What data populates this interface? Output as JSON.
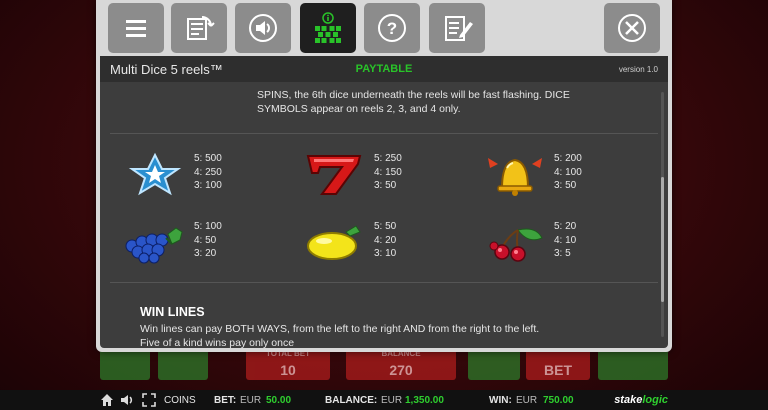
{
  "toolbar": {
    "buttons": [
      {
        "name": "menu-icon"
      },
      {
        "name": "autoplay-settings-icon"
      },
      {
        "name": "sound-icon"
      },
      {
        "name": "paytable-info-icon",
        "active": true
      },
      {
        "name": "help-icon"
      },
      {
        "name": "game-rules-icon"
      },
      {
        "name": "close-icon"
      }
    ]
  },
  "header": {
    "game_title": "Multi Dice 5 reels™",
    "tab_title": "PAYTABLE",
    "version": "version 1.0"
  },
  "paytable": {
    "intro": "SPINS, the 6th dice underneath the reels will be fast flashing. DICE SYMBOLS appear on reels 2, 3, and 4 only.",
    "items": [
      {
        "symbol": "star-icon",
        "pays": [
          "5: 500",
          "4: 250",
          "3: 100"
        ]
      },
      {
        "symbol": "seven-icon",
        "pays": [
          "5: 250",
          "4: 150",
          "3: 50"
        ]
      },
      {
        "symbol": "bell-icon",
        "pays": [
          "5: 200",
          "4: 100",
          "3: 50"
        ]
      },
      {
        "symbol": "grapes-icon",
        "pays": [
          "5: 100",
          "4: 50",
          "3: 20"
        ]
      },
      {
        "symbol": "lemon-icon",
        "pays": [
          "5: 50",
          "4: 20",
          "3: 10"
        ]
      },
      {
        "symbol": "cherries-icon",
        "pays": [
          "5: 20",
          "4: 10",
          "3: 5"
        ]
      }
    ],
    "win_lines_heading": "WIN LINES",
    "win_lines_text_1": "Win lines can pay BOTH WAYS, from the left to the right AND from the right to the left.",
    "win_lines_text_2": "Five of a kind wins pay only once"
  },
  "background_game": {
    "total_bet_caption": "TOTAL BET",
    "total_bet_value": "10",
    "balance_caption": "BALANCE",
    "balance_value": "270",
    "bet_caption": "BET"
  },
  "status_bar": {
    "coins_label": "COINS",
    "bet_label": "BET:",
    "bet_currency": "EUR",
    "bet_value": "50.00",
    "balance_label": "BALANCE:",
    "balance_currency": "EUR",
    "balance_value": "1,350.00",
    "win_label": "WIN:",
    "win_currency": "EUR",
    "win_value": "750.00",
    "logo_a": "stake",
    "logo_b": "logic"
  },
  "colors": {
    "accent_green": "#29c329",
    "panel_dark": "#3d3d3d",
    "toolbar_grey": "#8c8c8c"
  }
}
